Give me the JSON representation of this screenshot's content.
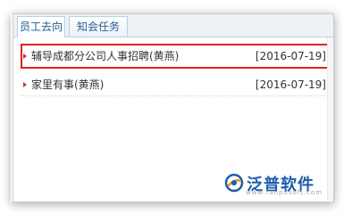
{
  "tabs": [
    {
      "label": "员工去向",
      "active": true
    },
    {
      "label": "知会任务",
      "active": false
    }
  ],
  "items": [
    {
      "title": "辅导成都分公司人事招聘(黄燕)",
      "date": "[2016-07-19]",
      "highlighted": true
    },
    {
      "title": "家里有事(黄燕)",
      "date": "[2016-07-19]",
      "highlighted": false
    }
  ],
  "logo": {
    "text": "泛普软件",
    "url": "www.fanpusoft.com",
    "icon": "fanpu-logo-icon"
  },
  "colors": {
    "tab_text": "#1a5a96",
    "highlight": "#e02020",
    "bullet": "#c0392b",
    "logo": "#1d5da8"
  }
}
